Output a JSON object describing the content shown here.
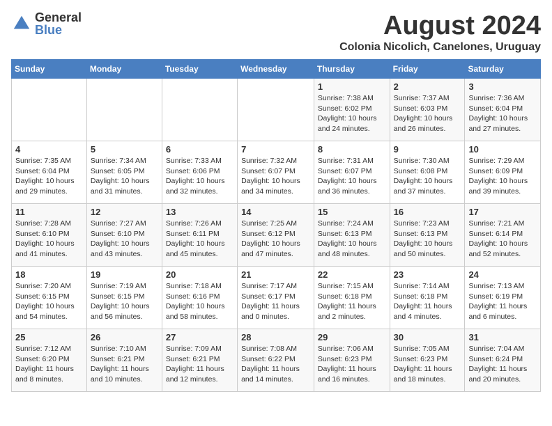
{
  "logo": {
    "general": "General",
    "blue": "Blue"
  },
  "title": {
    "month_year": "August 2024",
    "subtitle": "Colonia Nicolich, Canelones, Uruguay"
  },
  "weekdays": [
    "Sunday",
    "Monday",
    "Tuesday",
    "Wednesday",
    "Thursday",
    "Friday",
    "Saturday"
  ],
  "weeks": [
    [
      {
        "day": "",
        "info": ""
      },
      {
        "day": "",
        "info": ""
      },
      {
        "day": "",
        "info": ""
      },
      {
        "day": "",
        "info": ""
      },
      {
        "day": "1",
        "info": "Sunrise: 7:38 AM\nSunset: 6:02 PM\nDaylight: 10 hours and 24 minutes."
      },
      {
        "day": "2",
        "info": "Sunrise: 7:37 AM\nSunset: 6:03 PM\nDaylight: 10 hours and 26 minutes."
      },
      {
        "day": "3",
        "info": "Sunrise: 7:36 AM\nSunset: 6:04 PM\nDaylight: 10 hours and 27 minutes."
      }
    ],
    [
      {
        "day": "4",
        "info": "Sunrise: 7:35 AM\nSunset: 6:04 PM\nDaylight: 10 hours and 29 minutes."
      },
      {
        "day": "5",
        "info": "Sunrise: 7:34 AM\nSunset: 6:05 PM\nDaylight: 10 hours and 31 minutes."
      },
      {
        "day": "6",
        "info": "Sunrise: 7:33 AM\nSunset: 6:06 PM\nDaylight: 10 hours and 32 minutes."
      },
      {
        "day": "7",
        "info": "Sunrise: 7:32 AM\nSunset: 6:07 PM\nDaylight: 10 hours and 34 minutes."
      },
      {
        "day": "8",
        "info": "Sunrise: 7:31 AM\nSunset: 6:07 PM\nDaylight: 10 hours and 36 minutes."
      },
      {
        "day": "9",
        "info": "Sunrise: 7:30 AM\nSunset: 6:08 PM\nDaylight: 10 hours and 37 minutes."
      },
      {
        "day": "10",
        "info": "Sunrise: 7:29 AM\nSunset: 6:09 PM\nDaylight: 10 hours and 39 minutes."
      }
    ],
    [
      {
        "day": "11",
        "info": "Sunrise: 7:28 AM\nSunset: 6:10 PM\nDaylight: 10 hours and 41 minutes."
      },
      {
        "day": "12",
        "info": "Sunrise: 7:27 AM\nSunset: 6:10 PM\nDaylight: 10 hours and 43 minutes."
      },
      {
        "day": "13",
        "info": "Sunrise: 7:26 AM\nSunset: 6:11 PM\nDaylight: 10 hours and 45 minutes."
      },
      {
        "day": "14",
        "info": "Sunrise: 7:25 AM\nSunset: 6:12 PM\nDaylight: 10 hours and 47 minutes."
      },
      {
        "day": "15",
        "info": "Sunrise: 7:24 AM\nSunset: 6:13 PM\nDaylight: 10 hours and 48 minutes."
      },
      {
        "day": "16",
        "info": "Sunrise: 7:23 AM\nSunset: 6:13 PM\nDaylight: 10 hours and 50 minutes."
      },
      {
        "day": "17",
        "info": "Sunrise: 7:21 AM\nSunset: 6:14 PM\nDaylight: 10 hours and 52 minutes."
      }
    ],
    [
      {
        "day": "18",
        "info": "Sunrise: 7:20 AM\nSunset: 6:15 PM\nDaylight: 10 hours and 54 minutes."
      },
      {
        "day": "19",
        "info": "Sunrise: 7:19 AM\nSunset: 6:15 PM\nDaylight: 10 hours and 56 minutes."
      },
      {
        "day": "20",
        "info": "Sunrise: 7:18 AM\nSunset: 6:16 PM\nDaylight: 10 hours and 58 minutes."
      },
      {
        "day": "21",
        "info": "Sunrise: 7:17 AM\nSunset: 6:17 PM\nDaylight: 11 hours and 0 minutes."
      },
      {
        "day": "22",
        "info": "Sunrise: 7:15 AM\nSunset: 6:18 PM\nDaylight: 11 hours and 2 minutes."
      },
      {
        "day": "23",
        "info": "Sunrise: 7:14 AM\nSunset: 6:18 PM\nDaylight: 11 hours and 4 minutes."
      },
      {
        "day": "24",
        "info": "Sunrise: 7:13 AM\nSunset: 6:19 PM\nDaylight: 11 hours and 6 minutes."
      }
    ],
    [
      {
        "day": "25",
        "info": "Sunrise: 7:12 AM\nSunset: 6:20 PM\nDaylight: 11 hours and 8 minutes."
      },
      {
        "day": "26",
        "info": "Sunrise: 7:10 AM\nSunset: 6:21 PM\nDaylight: 11 hours and 10 minutes."
      },
      {
        "day": "27",
        "info": "Sunrise: 7:09 AM\nSunset: 6:21 PM\nDaylight: 11 hours and 12 minutes."
      },
      {
        "day": "28",
        "info": "Sunrise: 7:08 AM\nSunset: 6:22 PM\nDaylight: 11 hours and 14 minutes."
      },
      {
        "day": "29",
        "info": "Sunrise: 7:06 AM\nSunset: 6:23 PM\nDaylight: 11 hours and 16 minutes."
      },
      {
        "day": "30",
        "info": "Sunrise: 7:05 AM\nSunset: 6:23 PM\nDaylight: 11 hours and 18 minutes."
      },
      {
        "day": "31",
        "info": "Sunrise: 7:04 AM\nSunset: 6:24 PM\nDaylight: 11 hours and 20 minutes."
      }
    ]
  ]
}
